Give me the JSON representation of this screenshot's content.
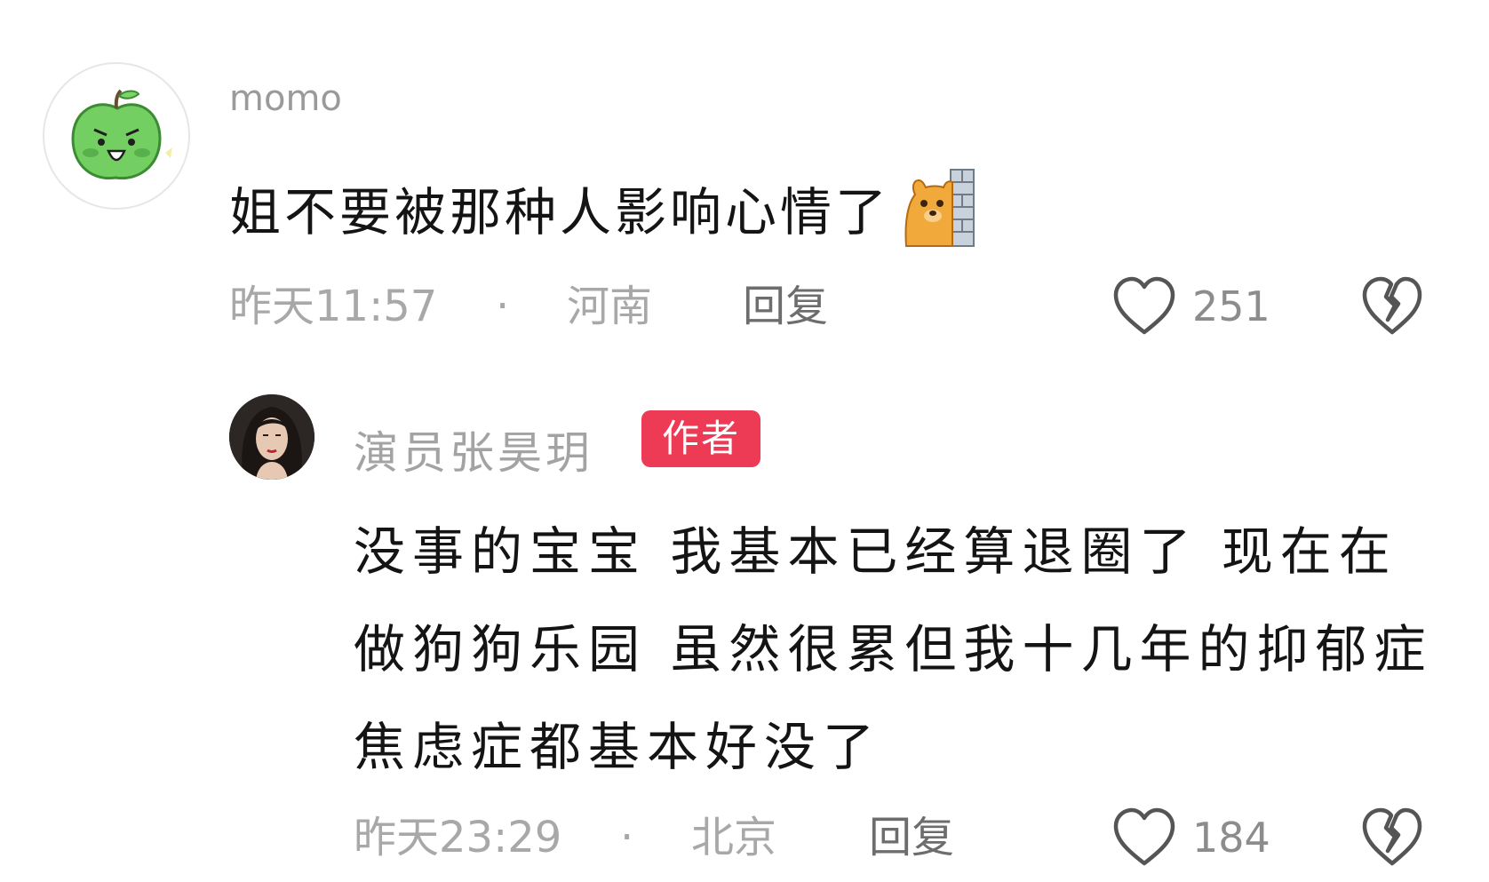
{
  "comment": {
    "username": "momo",
    "avatar_icon": "green-apple-avatar-icon",
    "text": "姐不要被那种人影响心情了",
    "emoji": "bear-peeking-emoji",
    "time": "昨天11:57",
    "separator": "·",
    "location": "河南",
    "reply_label": "回复",
    "like_count": "251"
  },
  "reply": {
    "username": "演员张昊玥",
    "author_badge": "作者",
    "text": "没事的宝宝  我基本已经算退圈了  现在在做狗狗乐园  虽然很累但我十几年的抑郁症焦虑症都基本好没了",
    "time": "昨天23:29",
    "separator": "·",
    "location": "北京",
    "reply_label": "回复",
    "like_count": "184"
  },
  "colors": {
    "author_badge": "#ee3b55",
    "meta_text": "#a8a8a8",
    "body_text": "#141414"
  }
}
